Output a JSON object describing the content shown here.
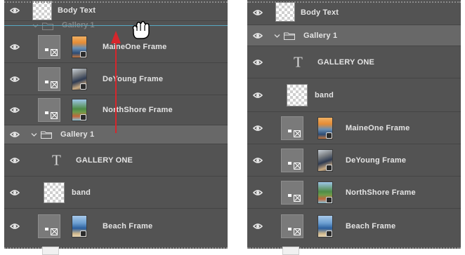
{
  "left_panel": {
    "ghost_row": {
      "label": "Gallery 1"
    },
    "layers": [
      {
        "id": "body-text",
        "label": "Body Text",
        "kind": "checker"
      },
      {
        "id": "maineone",
        "label": "MaineOne Frame",
        "kind": "frame",
        "photo": "thumb-maine"
      },
      {
        "id": "deyoung",
        "label": "DeYoung Frame",
        "kind": "frame",
        "photo": "thumb-deyoung"
      },
      {
        "id": "northshore",
        "label": "NorthShore Frame",
        "kind": "frame",
        "photo": "thumb-north"
      },
      {
        "id": "gallery1",
        "label": "Gallery 1",
        "kind": "group",
        "selected": true
      },
      {
        "id": "gallery-one",
        "label": "GALLERY ONE",
        "kind": "type"
      },
      {
        "id": "band",
        "label": "band",
        "kind": "checker"
      },
      {
        "id": "beach",
        "label": "Beach Frame",
        "kind": "frame",
        "photo": "thumb-beach"
      }
    ]
  },
  "right_panel": {
    "layers": [
      {
        "id": "body-text",
        "label": "Body Text",
        "kind": "checker"
      },
      {
        "id": "gallery1",
        "label": "Gallery 1",
        "kind": "group",
        "selected": true
      },
      {
        "id": "gallery-one",
        "label": "GALLERY ONE",
        "kind": "type"
      },
      {
        "id": "band",
        "label": "band",
        "kind": "checker"
      },
      {
        "id": "maineone",
        "label": "MaineOne Frame",
        "kind": "frame",
        "photo": "thumb-maine"
      },
      {
        "id": "deyoung",
        "label": "DeYoung Frame",
        "kind": "frame",
        "photo": "thumb-deyoung"
      },
      {
        "id": "northshore",
        "label": "NorthShore Frame",
        "kind": "frame",
        "photo": "thumb-north"
      },
      {
        "id": "beach",
        "label": "Beach Frame",
        "kind": "frame",
        "photo": "thumb-beach"
      }
    ]
  },
  "icons": {
    "eye": "eye-icon",
    "chevron": "chevron-down-icon",
    "folder": "folder-icon",
    "type": "T",
    "cursor": "grab-hand-icon"
  },
  "colors": {
    "panel_bg": "#535353",
    "selected_row": "#686868",
    "insertion_line": "#58a8c2",
    "drag_arrow": "#d6262c"
  }
}
